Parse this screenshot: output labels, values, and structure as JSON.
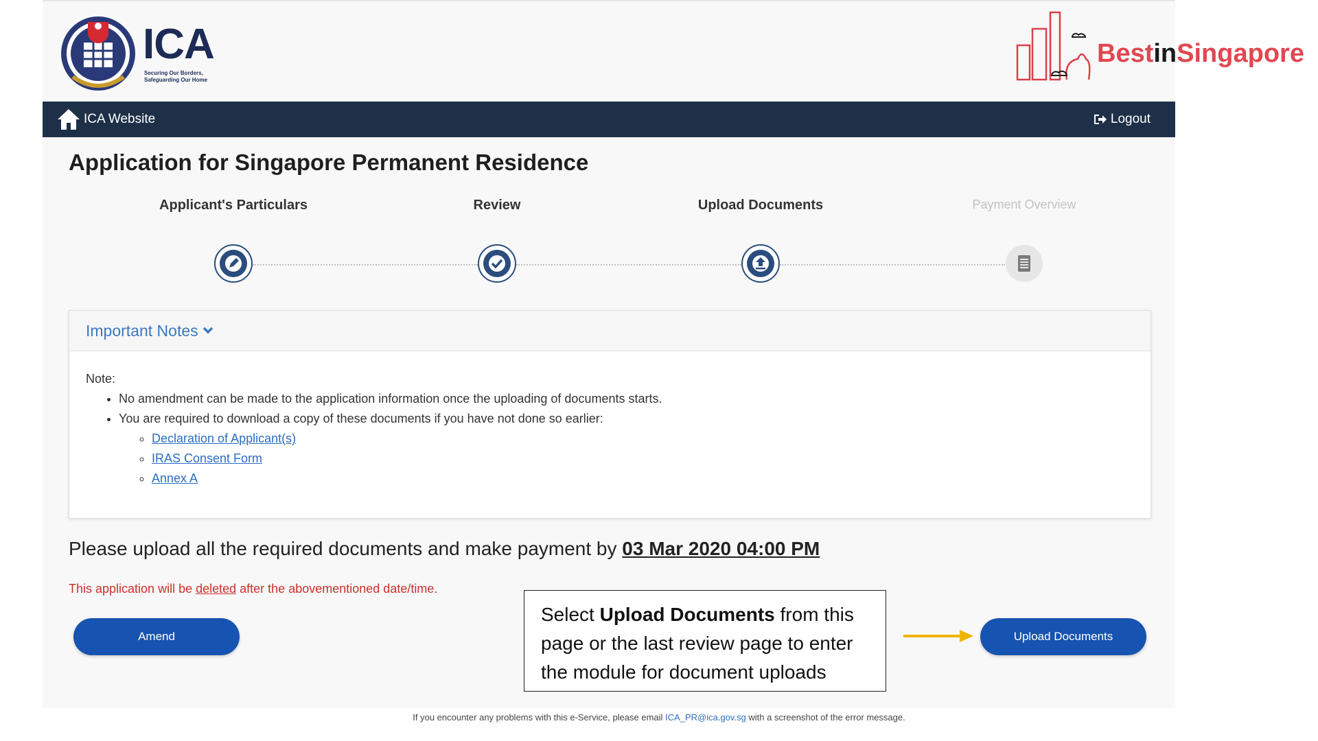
{
  "header": {
    "ica_logo_text": "ICA",
    "ica_tagline_line1": "Securing Our Borders,",
    "ica_tagline_line2": "Safeguarding Our Home",
    "brand_prefix": "Best",
    "brand_mid": "in",
    "brand_suffix": "Singapore"
  },
  "navbar": {
    "home_label": "ICA Website",
    "logout_label": "Logout"
  },
  "page_title": "Application for Singapore Permanent Residence",
  "steps": [
    {
      "label": "Applicant's Particulars",
      "icon": "pencil-icon",
      "state": "complete"
    },
    {
      "label": "Review",
      "icon": "check-icon",
      "state": "complete"
    },
    {
      "label": "Upload Documents",
      "icon": "upload-icon",
      "state": "current"
    },
    {
      "label": "Payment Overview",
      "icon": "document-icon",
      "state": "inactive"
    }
  ],
  "notes": {
    "header": "Important Notes",
    "note_label": "Note:",
    "bullets": [
      "No amendment can be made to the application information once the uploading of documents starts.",
      "You are required to download a copy of these documents if you have not done so earlier:"
    ],
    "links": [
      "Declaration of Applicant(s)",
      "IRAS Consent Form",
      "Annex A"
    ]
  },
  "deadline": {
    "prefix": "Please upload all the required documents and make payment by ",
    "date": "03 Mar 2020 04:00 PM"
  },
  "warning": {
    "prefix": "This application will be ",
    "emphasis": "deleted",
    "suffix": " after the abovementioned date/time."
  },
  "buttons": {
    "amend": "Amend",
    "upload": "Upload Documents"
  },
  "callout": {
    "prefix": "Select ",
    "bold": "Upload Documents",
    "suffix": " from this page or the last review page to enter the module for document uploads"
  },
  "footer": {
    "prefix": "If you encounter any problems with this e-Service, please email ",
    "email": "ICA_PR@ica.gov.sg",
    "suffix": " with a screenshot of the error message."
  },
  "colors": {
    "navbar": "#1e3048",
    "primary_button": "#1753b0",
    "link": "#2a6ec4",
    "warning": "#c9302c",
    "arrow": "#f0b400",
    "brand_red": "#e14750"
  }
}
